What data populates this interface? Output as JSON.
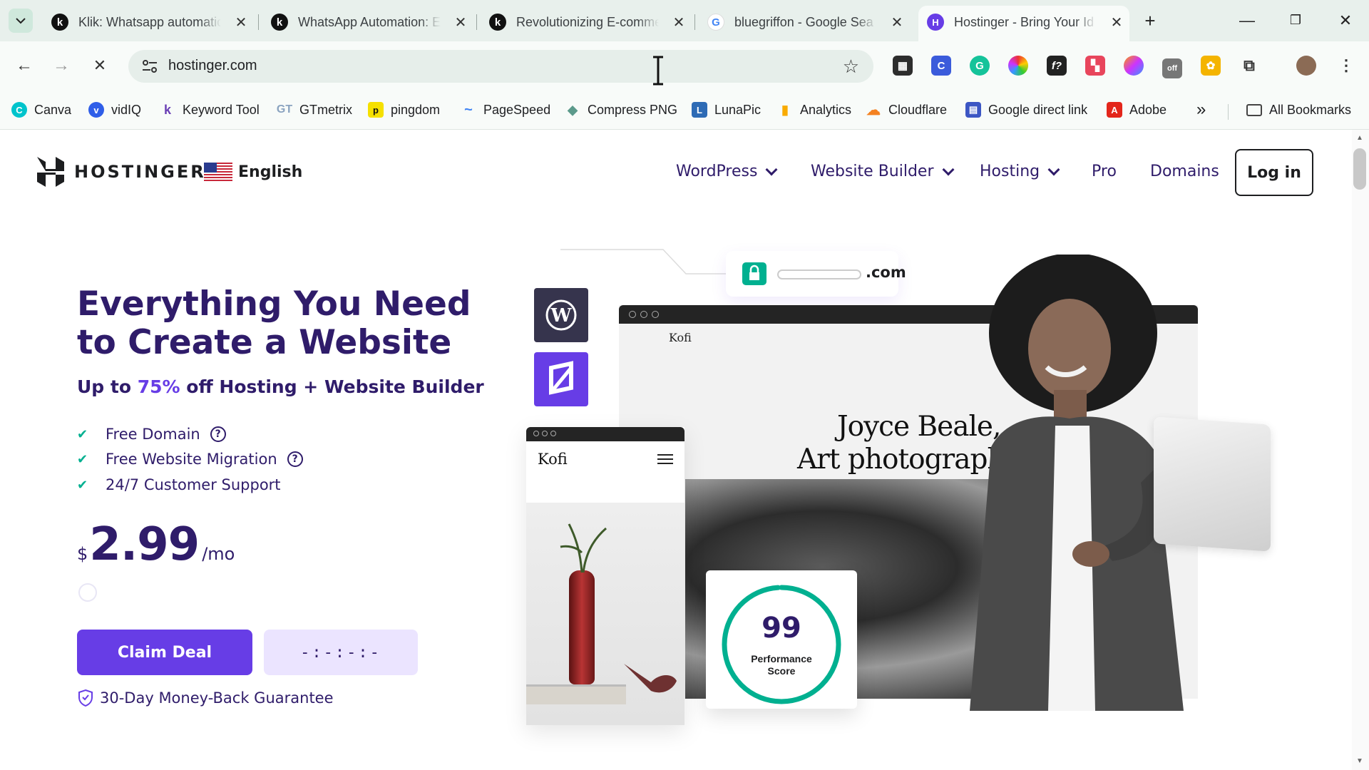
{
  "browser": {
    "tabs": [
      {
        "title": "Klik: Whatsapp automatic",
        "favicon": "k"
      },
      {
        "title": "WhatsApp Automation: E",
        "favicon": "k"
      },
      {
        "title": "Revolutionizing E-comme",
        "favicon": "k"
      },
      {
        "title": "bluegriffon - Google Sea",
        "favicon": "G"
      },
      {
        "title": "Hostinger - Bring Your Id",
        "favicon": "H",
        "active": true
      }
    ],
    "url": "hostinger.com",
    "bookmarks": [
      {
        "label": "Canva",
        "color": "#00c4cc",
        "glyph": "C"
      },
      {
        "label": "vidIQ",
        "color": "#2f5ee8",
        "glyph": "v"
      },
      {
        "label": "Keyword Tool",
        "color": "#6a3fb5",
        "glyph": "k"
      },
      {
        "label": "GTmetrix",
        "color": "#8aa3c0",
        "glyph": "GT"
      },
      {
        "label": "pingdom",
        "color": "#f5e000",
        "glyph": "p"
      },
      {
        "label": "PageSpeed",
        "color": "#4285f4",
        "glyph": "~"
      },
      {
        "label": "Compress PNG",
        "color": "#5b9a8b",
        "glyph": "◆"
      },
      {
        "label": "LunaPic",
        "color": "#2e6bb5",
        "glyph": "L"
      },
      {
        "label": "Analytics",
        "color": "#f9ab00",
        "glyph": "▮"
      },
      {
        "label": "Cloudflare",
        "color": "#f48120",
        "glyph": "☁"
      },
      {
        "label": "Google direct link",
        "color": "#3c56c4",
        "glyph": "▤"
      },
      {
        "label": "Adobe",
        "color": "#e3261b",
        "glyph": "A"
      }
    ],
    "more_bookmarks": "»",
    "all_bookmarks": "All Bookmarks"
  },
  "site": {
    "brand": "HOSTINGER",
    "language": "English",
    "nav": [
      {
        "label": "WordPress",
        "dropdown": true
      },
      {
        "label": "Website Builder",
        "dropdown": true
      },
      {
        "label": "Hosting",
        "dropdown": true
      },
      {
        "label": "Pro",
        "dropdown": false
      },
      {
        "label": "Domains",
        "dropdown": false
      }
    ],
    "login": "Log in"
  },
  "hero": {
    "title": "Everything You Need to Create a Website",
    "subtitle_pre": "Up to ",
    "subtitle_pct": "75%",
    "subtitle_post": " off Hosting + Website Builder",
    "features": [
      {
        "label": "Free Domain",
        "help": true
      },
      {
        "label": "Free Website Migration",
        "help": true
      },
      {
        "label": "24/7 Customer Support",
        "help": false
      }
    ],
    "price": {
      "currency": "$",
      "amount": "2.99",
      "period": "/mo"
    },
    "cta": "Claim Deal",
    "timer": "-:-:-:-",
    "guarantee": "30-Day Money-Back Guarantee"
  },
  "illustration": {
    "domain_tld": ".com",
    "desktop_brand": "Kofi",
    "desktop_headline_1": "Joyce Beale,",
    "desktop_headline_2": "Art photograph",
    "mobile_brand": "Kofi",
    "performance_value": "99",
    "performance_label": "Performance Score",
    "performance_fraction": 0.99
  },
  "colors": {
    "brand_purple": "#673de6",
    "brand_navy": "#2f1c6a",
    "accent_green": "#00b090"
  }
}
